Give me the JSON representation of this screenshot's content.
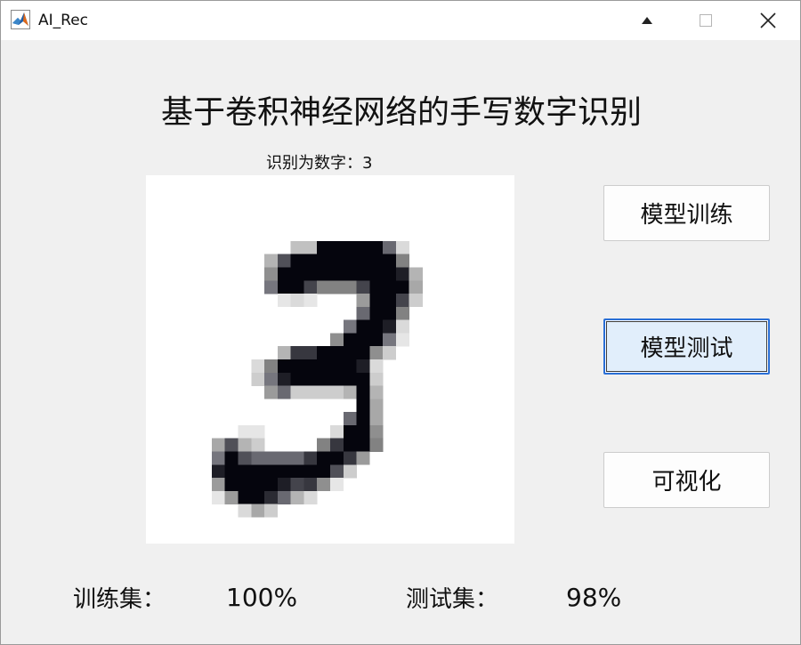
{
  "window": {
    "title": "AI_Rec",
    "controls": [
      "minimize-icon",
      "maximize-icon",
      "close-icon"
    ]
  },
  "header": {
    "title": "基于卷积神经网络的手写数字识别"
  },
  "result": {
    "label": "识别为数字：",
    "value": "3"
  },
  "buttons": {
    "train": "模型训练",
    "test": "模型测试",
    "visualize": "可视化",
    "active": "test"
  },
  "stats": {
    "train_label": "训练集：",
    "train_value": "100%",
    "test_label": "测试集：",
    "test_value": "98%"
  },
  "colors": {
    "window_bg": "#f0f0f0",
    "titlebar_bg": "#ffffff",
    "active_button_bg": "#e1eefb",
    "active_button_border": "#2a6fd6"
  }
}
